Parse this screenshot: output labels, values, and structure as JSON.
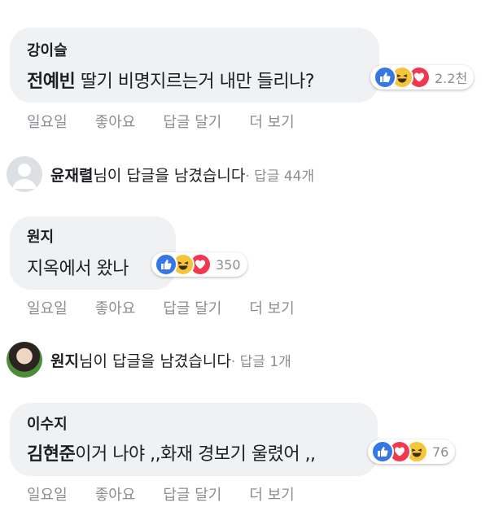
{
  "comments": [
    {
      "author": "강이슬",
      "tag": "전예빈",
      "text": " 딸기 비명지르는거 내만 들리나?",
      "reactions": [
        "like",
        "haha",
        "love"
      ],
      "count": "2.2천",
      "actions": [
        "일요일",
        "좋아요",
        "답글 달기",
        "더 보기"
      ]
    },
    {
      "author": "원지",
      "tag": "",
      "text": "지옥에서 왔나",
      "reactions": [
        "like",
        "haha",
        "love"
      ],
      "count": "350",
      "actions": [
        "일요일",
        "좋아요",
        "답글 달기",
        "더 보기"
      ]
    },
    {
      "author": "이수지",
      "tag": "김현준",
      "text": "이거 나야 ,,화재 경보기 울렸어 ,,",
      "reactions": [
        "like",
        "love",
        "haha"
      ],
      "count": "76",
      "actions": [
        "일요일",
        "좋아요",
        "답글 달기",
        "더 보기"
      ]
    }
  ],
  "replies": [
    {
      "name": "윤재렬",
      "suffix": "님이 답글을 남겼습니다",
      "meta": " · 답글 44개",
      "avatar": "default"
    },
    {
      "name": "원지",
      "suffix": "님이 답글을 남겼습니다",
      "meta": " · 답글 1개",
      "avatar": "photo"
    }
  ],
  "colors": {
    "bubble": "#eff1f3",
    "like": "#3578e5",
    "haha": "#f7c53a",
    "love": "#f0384f",
    "meta": "#8a8d91"
  }
}
